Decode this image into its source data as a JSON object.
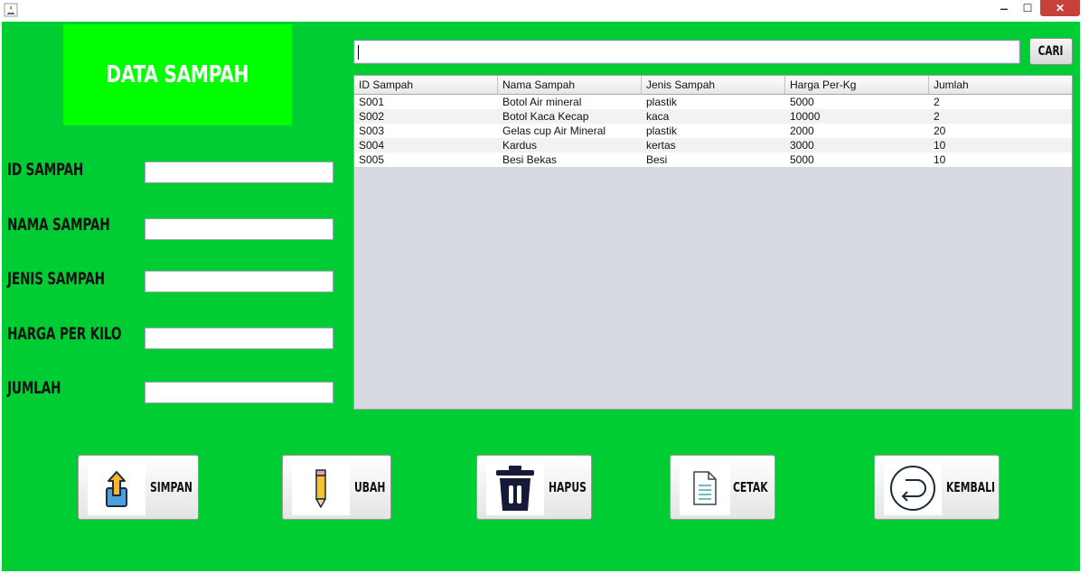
{
  "window": {
    "minimize_glyph": "‒",
    "maximize_glyph": "☐",
    "close_glyph": "✕",
    "accent_close": "#c7413a"
  },
  "colors": {
    "frame_bg": "#00cc33",
    "title_panel_bg": "#00ff00"
  },
  "title": "DATA SAMPAH",
  "form": {
    "fields": [
      {
        "label": "ID SAMPAH",
        "value": ""
      },
      {
        "label": "NAMA SAMPAH",
        "value": ""
      },
      {
        "label": "JENIS SAMPAH",
        "value": ""
      },
      {
        "label": "HARGA PER KILO",
        "value": ""
      },
      {
        "label": "JUMLAH",
        "value": ""
      }
    ]
  },
  "search": {
    "value": "",
    "button_label": "CARI"
  },
  "table": {
    "columns": [
      "ID Sampah",
      "Nama Sampah",
      "Jenis Sampah",
      "Harga Per-Kg",
      "Jumlah"
    ],
    "rows": [
      [
        "S001",
        "Botol Air mineral",
        "plastik",
        "5000",
        "2"
      ],
      [
        "S002",
        "Botol Kaca Kecap",
        "kaca",
        "10000",
        "2"
      ],
      [
        "S003",
        "Gelas cup Air Mineral",
        "plastik",
        "2000",
        "20"
      ],
      [
        "S004",
        "Kardus",
        "kertas",
        "3000",
        "10"
      ],
      [
        "S005",
        "Besi Bekas",
        "Besi",
        "5000",
        "10"
      ]
    ]
  },
  "actions": [
    {
      "label": "SIMPAN",
      "icon": "upload-icon"
    },
    {
      "label": "UBAH",
      "icon": "pencil-icon"
    },
    {
      "label": "HAPUS",
      "icon": "trash-icon"
    },
    {
      "label": "CETAK",
      "icon": "document-icon"
    },
    {
      "label": "KEMBALI",
      "icon": "return-icon"
    }
  ]
}
